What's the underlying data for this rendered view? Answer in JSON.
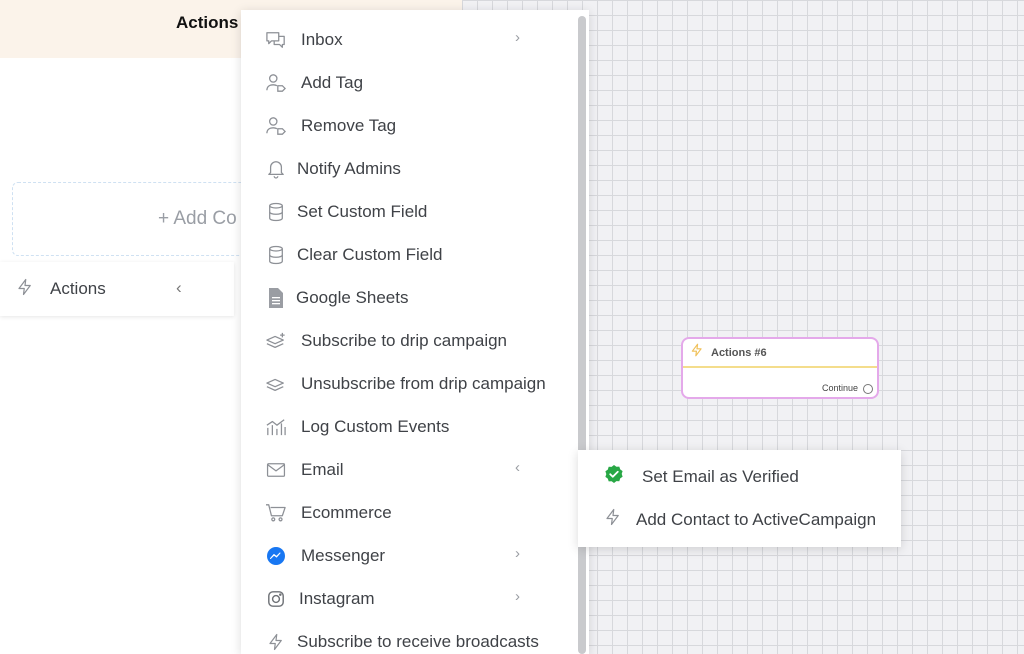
{
  "left_panel": {
    "title": "Actions",
    "add_contact_label": "+ Add Co",
    "actions_row_label": "Actions",
    "actions_row_chevron": "‹"
  },
  "menu": {
    "items": [
      {
        "label": "Inbox",
        "icon": "chat-bubbles-icon",
        "has_submenu": true
      },
      {
        "label": "Add Tag",
        "icon": "user-tag-icon",
        "has_submenu": false
      },
      {
        "label": "Remove Tag",
        "icon": "user-tag-icon",
        "has_submenu": false
      },
      {
        "label": "Notify Admins",
        "icon": "bell-icon",
        "has_submenu": false
      },
      {
        "label": "Set Custom Field",
        "icon": "database-icon",
        "has_submenu": false
      },
      {
        "label": "Clear Custom Field",
        "icon": "database-icon",
        "has_submenu": false
      },
      {
        "label": "Google Sheets",
        "icon": "sheet-icon",
        "has_submenu": false
      },
      {
        "label": "Subscribe to drip campaign",
        "icon": "layers-plus-icon",
        "has_submenu": false
      },
      {
        "label": "Unsubscribe from drip campaign",
        "icon": "layers-icon",
        "has_submenu": false
      },
      {
        "label": "Log Custom Events",
        "icon": "chart-icon",
        "has_submenu": false
      },
      {
        "label": "Email",
        "icon": "envelope-icon",
        "has_submenu": true,
        "expanded": true
      },
      {
        "label": "Ecommerce",
        "icon": "cart-icon",
        "has_submenu": false
      },
      {
        "label": "Messenger",
        "icon": "messenger-icon",
        "has_submenu": true
      },
      {
        "label": "Instagram",
        "icon": "instagram-icon",
        "has_submenu": true
      },
      {
        "label": "Subscribe to receive broadcasts",
        "icon": "bolt-icon",
        "has_submenu": false
      }
    ],
    "arrow_right": "›",
    "arrow_left": "‹"
  },
  "submenu": {
    "items": [
      {
        "label": "Set Email as Verified",
        "icon": "verified-check-icon"
      },
      {
        "label": "Add Contact to ActiveCampaign",
        "icon": "bolt-icon"
      }
    ]
  },
  "node": {
    "title": "Actions #6",
    "continue_label": "Continue"
  },
  "colors": {
    "header_bg": "#fbf3ea",
    "node_border": "#e4a9ea",
    "node_divider": "#f4dd8c",
    "verified_green": "#28a745",
    "messenger_blue": "#1877f2"
  }
}
